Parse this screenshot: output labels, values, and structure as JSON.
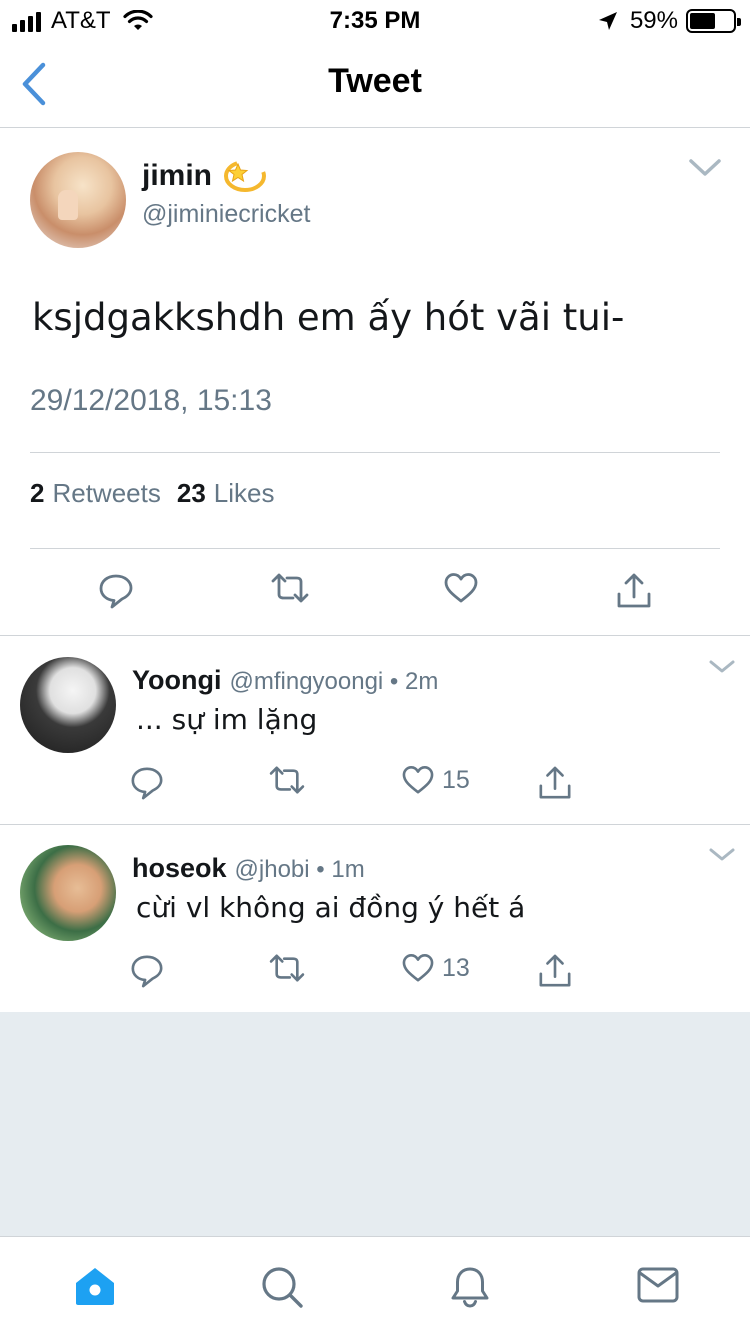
{
  "status_bar": {
    "carrier": "AT&T",
    "time": "7:35 PM",
    "battery_percent": "59%",
    "battery_level": 0.59
  },
  "nav": {
    "title": "Tweet",
    "back_icon": "chevron-left-icon"
  },
  "tweet": {
    "name": "jimin",
    "emoji_icon": "dizzy-icon",
    "handle": "@jiminiecricket",
    "text": "ksjdgakkshdh em ấy hót vãi tui-",
    "timestamp": "29/12/2018, 15:13",
    "retweets_count": "2",
    "retweets_label": "Retweets",
    "likes_count": "23",
    "likes_label": "Likes"
  },
  "replies": [
    {
      "name": "Yoongi",
      "meta": "@mfingyoongi • 2m",
      "text": "... sự im lặng",
      "like_count": "15"
    },
    {
      "name": "hoseok",
      "meta": "@jhobi • 1m",
      "text": "cừi vl không ai đồng ý hết á",
      "like_count": "13"
    }
  ],
  "tab_bar": {
    "tabs": [
      "home-icon",
      "search-icon",
      "notifications-icon",
      "messages-icon"
    ],
    "active": "home-icon"
  },
  "colors": {
    "accent": "#1da1f2",
    "nav_blue": "#4a90d9",
    "text": "#14171a",
    "secondary": "#657786",
    "icon": "#657786",
    "background_gray": "#e6ecf0"
  }
}
